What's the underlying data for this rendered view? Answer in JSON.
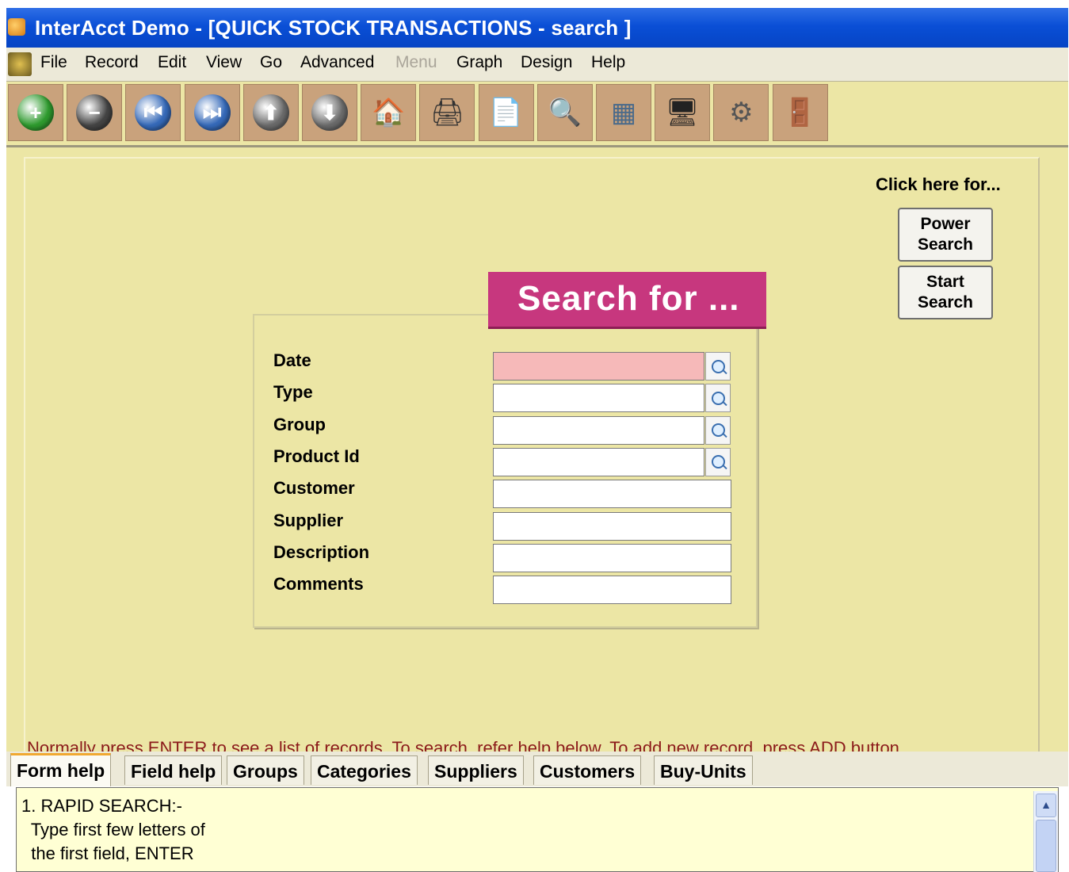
{
  "window": {
    "title": "InterAcct Demo - [QUICK STOCK TRANSACTIONS - search ]"
  },
  "menu": {
    "items": [
      {
        "label": "File",
        "enabled": true
      },
      {
        "label": "Record",
        "enabled": true
      },
      {
        "label": "Edit",
        "enabled": true
      },
      {
        "label": "View",
        "enabled": true
      },
      {
        "label": "Go",
        "enabled": true
      },
      {
        "label": "Advanced",
        "enabled": true
      },
      {
        "label": "Menu",
        "enabled": false
      },
      {
        "label": "Graph",
        "enabled": true
      },
      {
        "label": "Design",
        "enabled": true
      },
      {
        "label": "Help",
        "enabled": true
      }
    ]
  },
  "toolbar": {
    "buttons": [
      {
        "icon": "add-icon",
        "glyph": "+",
        "color": "#2e9a2e"
      },
      {
        "icon": "remove-icon",
        "glyph": "−",
        "color": "#444444"
      },
      {
        "icon": "first-record-icon",
        "glyph": "⏮",
        "color": "#3569b8"
      },
      {
        "icon": "last-record-icon",
        "glyph": "⏭",
        "color": "#3569b8"
      },
      {
        "icon": "previous-icon",
        "glyph": "⬆",
        "color": "#6a6a6a"
      },
      {
        "icon": "next-icon",
        "glyph": "⬇",
        "color": "#6a6a6a"
      },
      {
        "icon": "home-icon",
        "glyph": "🏠",
        "color": "#c0392b"
      },
      {
        "icon": "print-icon",
        "glyph": "🖨",
        "color": "#333333"
      },
      {
        "icon": "export-document-icon",
        "glyph": "📄",
        "color": "#555555"
      },
      {
        "icon": "search-icon",
        "glyph": "🔍",
        "color": "#555555"
      },
      {
        "icon": "data-grid-icon",
        "glyph": "▦",
        "color": "#4a6a8a"
      },
      {
        "icon": "monitor-icon",
        "glyph": "🖥",
        "color": "#222222"
      },
      {
        "icon": "settings-gear-icon",
        "glyph": "⚙",
        "color": "#555555"
      },
      {
        "icon": "exit-door-icon",
        "glyph": "🚪",
        "color": "#8b4513"
      }
    ]
  },
  "side_panel": {
    "click_here": "Click here for...",
    "power_search": [
      "Power",
      "Search"
    ],
    "start_search": [
      "Start",
      "Search"
    ]
  },
  "search_form": {
    "heading": "Search for ...",
    "fields": [
      {
        "label": "Date",
        "value": "",
        "lookup": true,
        "highlighted": true
      },
      {
        "label": "Type",
        "value": "",
        "lookup": true,
        "highlighted": false
      },
      {
        "label": "Group",
        "value": "",
        "lookup": true,
        "highlighted": false
      },
      {
        "label": "Product Id",
        "value": "",
        "lookup": true,
        "highlighted": false
      },
      {
        "label": "Customer",
        "value": "",
        "lookup": false,
        "highlighted": false
      },
      {
        "label": "Supplier",
        "value": "",
        "lookup": false,
        "highlighted": false
      },
      {
        "label": "Description",
        "value": "",
        "lookup": false,
        "highlighted": false
      },
      {
        "label": "Comments",
        "value": "",
        "lookup": false,
        "highlighted": false
      }
    ]
  },
  "hint": "Normally press ENTER to see a list of records. To search, refer help below. To add new record, press ADD button",
  "tabs": [
    {
      "label": "Form help",
      "active": true
    },
    {
      "label": "Field help",
      "active": false
    },
    {
      "label": "Groups",
      "active": false
    },
    {
      "label": "Categories",
      "active": false
    },
    {
      "label": "Suppliers",
      "active": false
    },
    {
      "label": "Customers",
      "active": false
    },
    {
      "label": "Buy-Units",
      "active": false
    }
  ],
  "help_text": [
    "1. RAPID SEARCH:-",
    "  Type first few letters of",
    "  the first field, ENTER"
  ],
  "colors": {
    "title_bar": "#0a4fd6",
    "panel_bg": "#ece6a5",
    "heading_bg": "#c7377e",
    "highlight_field": "#f6b9b9",
    "hint_text": "#8b1a1a",
    "help_bg": "#ffffd4"
  }
}
